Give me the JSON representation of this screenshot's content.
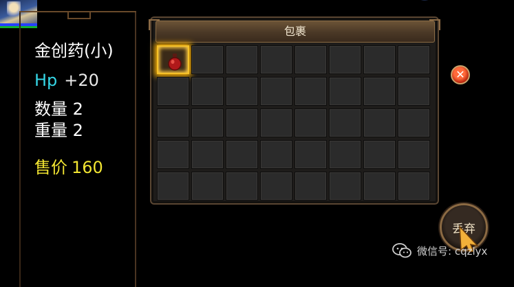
{
  "item": {
    "name": "金创药(小)",
    "hp_label": "Hp",
    "hp_value": "+20",
    "quantity_label": "数量",
    "quantity": "2",
    "weight_label": "重量",
    "weight": "2",
    "price_label": "售价",
    "price": "160"
  },
  "bag": {
    "title": "包裹",
    "columns": 8,
    "rows": 5,
    "selected_slot": 1,
    "slots": [
      {
        "item": "red-potion-icon"
      },
      {},
      {},
      {},
      {},
      {},
      {},
      {},
      {},
      {},
      {},
      {},
      {},
      {},
      {},
      {},
      {},
      {},
      {},
      {},
      {},
      {},
      {},
      {},
      {},
      {},
      {},
      {},
      {},
      {},
      {},
      {},
      {},
      {},
      {},
      {},
      {},
      {},
      {},
      {}
    ]
  },
  "buttons": {
    "close_icon": "close-icon",
    "discard_label": "丢弃"
  },
  "watermark": {
    "text": "微信号: cqzlyx"
  },
  "colors": {
    "hp_label": "#35d6e6",
    "price": "#f2e532",
    "selection_glow": "#ffb300",
    "close_button": "#d8401c"
  }
}
